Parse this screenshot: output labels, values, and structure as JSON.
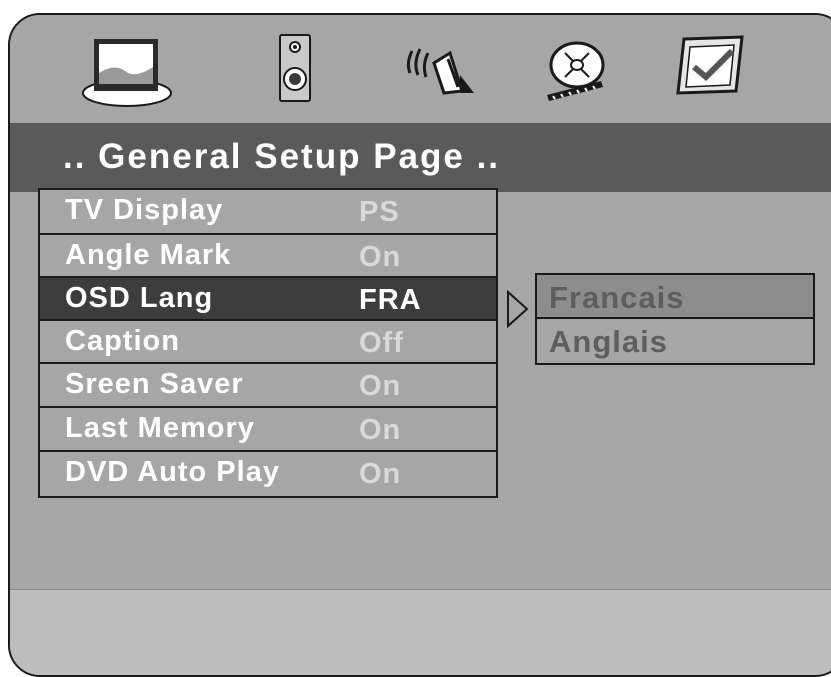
{
  "header": {
    "title": ".. General Setup Page .."
  },
  "icons": [
    "tv-monitor-icon",
    "speaker-icon",
    "audio-sound-icon",
    "video-film-icon",
    "preference-check-icon"
  ],
  "menu": {
    "items": [
      {
        "label": "TV  Display",
        "value": "PS",
        "selected": false
      },
      {
        "label": "Angle Mark",
        "value": "On",
        "selected": false
      },
      {
        "label": "OSD  Lang",
        "value": "FRA",
        "selected": true
      },
      {
        "label": "Caption",
        "value": "Off",
        "selected": false
      },
      {
        "label": "Sreen Saver",
        "value": "On",
        "selected": false
      },
      {
        "label": "Last Memory",
        "value": "On",
        "selected": false
      },
      {
        "label": "DVD Auto Play",
        "value": "On",
        "selected": false
      }
    ]
  },
  "submenu": {
    "options": [
      {
        "label": "Francais",
        "highlighted": true
      },
      {
        "label": "Anglais",
        "highlighted": false
      }
    ]
  },
  "colors": {
    "background": "#a6a6a6",
    "title_bar": "#5a5a5a",
    "selected_row": "#3d3d3d",
    "border": "#1a1a1a"
  }
}
